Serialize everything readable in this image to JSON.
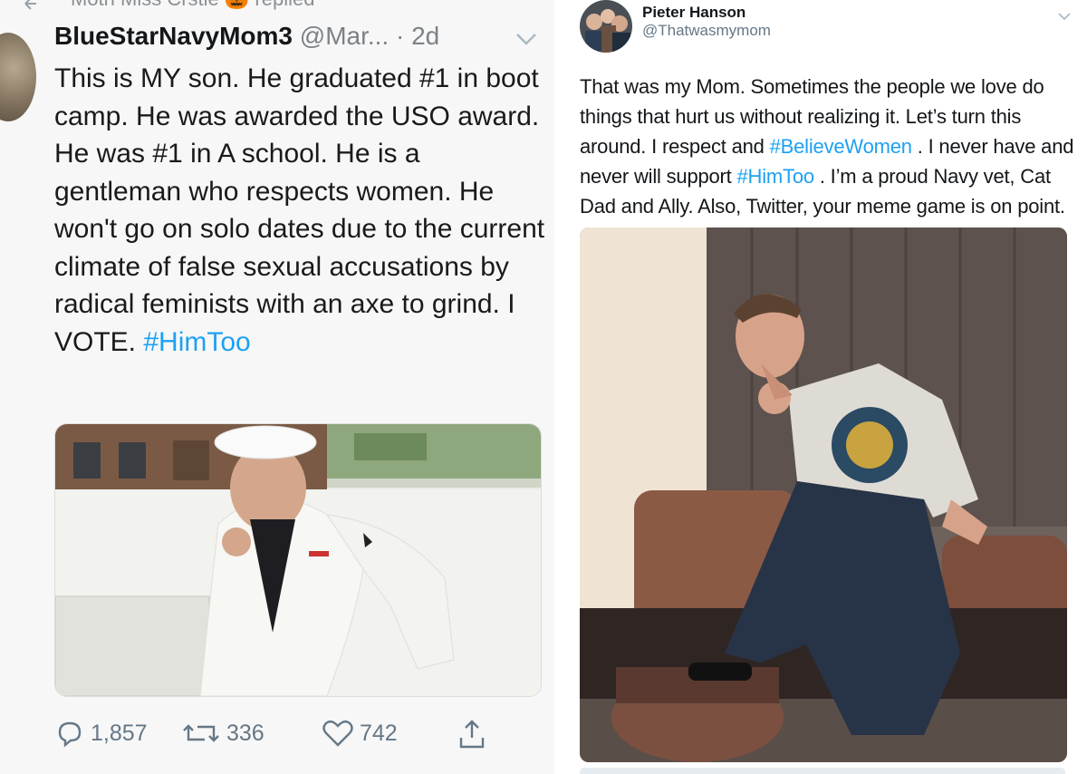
{
  "left_tweet": {
    "reply_context": "Moth Miss Crstie 🎃 replied",
    "author_name": "BlueStarNavyMom3",
    "author_handle": "@Mar...",
    "separator": "·",
    "time": "2d",
    "text": "This is MY son. He graduated #1 in boot camp. He was awarded the USO award. He was #1 in A school. He is a gentleman who respects women. He won't go on solo dates due to the current climate of false sexual accusations by radical feminists with an axe to grind. I VOTE.",
    "hashtag": "#HimToo",
    "actions": {
      "replies": "1,857",
      "retweets": "336",
      "likes": "742"
    },
    "icons": [
      "reply-icon",
      "retweet-icon",
      "heart-icon",
      "share-icon",
      "chevron-down-icon"
    ]
  },
  "right_tweet": {
    "author_name": "Pieter Hanson",
    "author_handle": "@Thatwasmymom",
    "text_part1": "That was my Mom. Sometimes the people we love do things that hurt us without realizing it. Let’s turn this around. I respect and",
    "hashtag1": "#BelieveWomen",
    "text_part2": ". I never have and never will support",
    "hashtag2": "#HimToo",
    "text_part3": ". I’m a proud Navy vet, Cat Dad and Ally. Also, Twitter, your meme game is on point.",
    "icons": [
      "chevron-down-icon"
    ]
  },
  "colors": {
    "hashtag": "#1da1f2",
    "secondary_text": "#657786",
    "primary_text": "#14171a"
  }
}
